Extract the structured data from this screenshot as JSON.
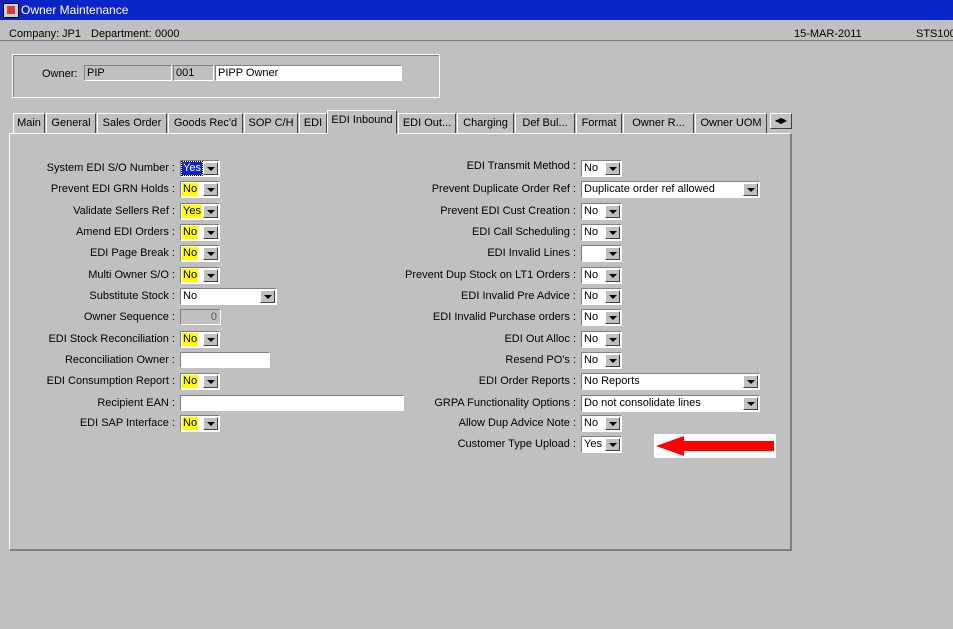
{
  "window": {
    "title": "Owner Maintenance"
  },
  "info": {
    "company_label": "Company:",
    "company": "JP1",
    "department_label": "Department:",
    "department": "0000",
    "date": "15-MAR-2011",
    "code": "STS100"
  },
  "owner": {
    "label": "Owner:",
    "id": "PIP",
    "number": "001",
    "name": "PIPP Owner"
  },
  "tabs": [
    {
      "label": "Main"
    },
    {
      "label": "General"
    },
    {
      "label": "Sales Order"
    },
    {
      "label": "Goods Rec'd"
    },
    {
      "label": "SOP C/H"
    },
    {
      "label": "EDI"
    },
    {
      "label": "EDI Inbound"
    },
    {
      "label": "EDI Out..."
    },
    {
      "label": "Charging"
    },
    {
      "label": "Def Bul..."
    },
    {
      "label": "Format"
    },
    {
      "label": "Owner R..."
    },
    {
      "label": "Owner UOM"
    }
  ],
  "active_tab": "EDI Inbound",
  "left_fields": [
    {
      "label": "System EDI S/O Number :",
      "value": "Yes"
    },
    {
      "label": "Prevent EDI GRN Holds :",
      "value": "No"
    },
    {
      "label": "Validate Sellers Ref :",
      "value": "Yes"
    },
    {
      "label": "Amend EDI Orders :",
      "value": "No"
    },
    {
      "label": "EDI Page Break :",
      "value": "No"
    },
    {
      "label": "Multi Owner S/O :",
      "value": "No"
    },
    {
      "label": "Substitute Stock :",
      "value": "No"
    },
    {
      "label": "Owner Sequence :",
      "value": "0"
    },
    {
      "label": "EDI Stock Reconciliation :",
      "value": "No"
    },
    {
      "label": "Reconciliation Owner :",
      "value": ""
    },
    {
      "label": "EDI Consumption Report :",
      "value": "No"
    },
    {
      "label": "Recipient EAN :",
      "value": ""
    },
    {
      "label": "EDI SAP Interface :",
      "value": "No"
    }
  ],
  "right_fields": [
    {
      "label": "EDI Transmit Method :",
      "value": "No"
    },
    {
      "label": "Prevent Duplicate Order Ref :",
      "value": "Duplicate order ref allowed"
    },
    {
      "label": "Prevent EDI Cust Creation :",
      "value": "No"
    },
    {
      "label": "EDI Call Scheduling :",
      "value": "No"
    },
    {
      "label": "EDI Invalid Lines :",
      "value": ""
    },
    {
      "label": "Prevent Dup Stock on LT1 Orders :",
      "value": "No"
    },
    {
      "label": "EDI Invalid Pre Advice :",
      "value": "No"
    },
    {
      "label": "EDI Invalid Purchase orders :",
      "value": "No"
    },
    {
      "label": "EDI Out Alloc :",
      "value": "No"
    },
    {
      "label": "Resend PO's :",
      "value": "No"
    },
    {
      "label": "EDI Order Reports :",
      "value": "No Reports"
    },
    {
      "label": "GRPA Functionality Options :",
      "value": "Do not consolidate lines"
    },
    {
      "label": "Allow Dup Advice Note :",
      "value": "No"
    },
    {
      "label": "Customer Type Upload :",
      "value": "Yes"
    }
  ],
  "colors": {
    "title_bar": "#0a24c8",
    "highlight": "#ffff00",
    "arrow": "#ff0000"
  },
  "icons": {
    "app": "app-icon",
    "annotation": "red-arrow-icon",
    "tab_scroll": "scroll-arrows-icon"
  }
}
